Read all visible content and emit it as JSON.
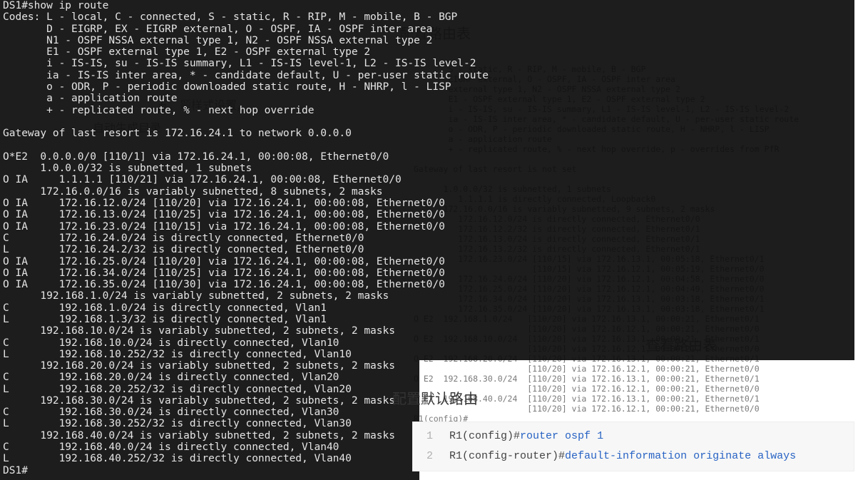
{
  "captions": {
    "topright": "配置路由表",
    "midleft1": "五、题样式设置,",
    "midleft2": "自动生成目录",
    "midright": "查看路由表",
    "center": "配置默认路由"
  },
  "front_terminal": "DS1#show ip route\nCodes: L - local, C - connected, S - static, R - RIP, M - mobile, B - BGP\n       D - EIGRP, EX - EIGRP external, O - OSPF, IA - OSPF inter area\n       N1 - OSPF NSSA external type 1, N2 - OSPF NSSA external type 2\n       E1 - OSPF external type 1, E2 - OSPF external type 2\n       i - IS-IS, su - IS-IS summary, L1 - IS-IS level-1, L2 - IS-IS level-2\n       ia - IS-IS inter area, * - candidate default, U - per-user static route\n       o - ODR, P - periodic downloaded static route, H - NHRP, l - LISP\n       a - application route\n       + - replicated route, % - next hop override\n\nGateway of last resort is 172.16.24.1 to network 0.0.0.0\n\nO*E2  0.0.0.0/0 [110/1] via 172.16.24.1, 00:00:08, Ethernet0/0\n      1.0.0.0/32 is subnetted, 1 subnets\nO IA     1.1.1.1 [110/21] via 172.16.24.1, 00:00:08, Ethernet0/0\n      172.16.0.0/16 is variably subnetted, 8 subnets, 2 masks\nO IA     172.16.12.0/24 [110/20] via 172.16.24.1, 00:00:08, Ethernet0/0\nO IA     172.16.13.0/24 [110/25] via 172.16.24.1, 00:00:08, Ethernet0/0\nO IA     172.16.23.0/24 [110/15] via 172.16.24.1, 00:00:08, Ethernet0/0\nC        172.16.24.0/24 is directly connected, Ethernet0/0\nL        172.16.24.2/32 is directly connected, Ethernet0/0\nO IA     172.16.25.0/24 [110/20] via 172.16.24.1, 00:00:08, Ethernet0/0\nO IA     172.16.34.0/24 [110/25] via 172.16.24.1, 00:00:08, Ethernet0/0\nO IA     172.16.35.0/24 [110/30] via 172.16.24.1, 00:00:08, Ethernet0/0\n      192.168.1.0/24 is variably subnetted, 2 subnets, 2 masks\nC        192.168.1.0/24 is directly connected, Vlan1\nL        192.168.1.3/32 is directly connected, Vlan1\n      192.168.10.0/24 is variably subnetted, 2 subnets, 2 masks\nC        192.168.10.0/24 is directly connected, Vlan10\nL        192.168.10.252/32 is directly connected, Vlan10",
  "front_terminal_cont": "      192.168.20.0/24 is variably subnetted, 2 subnets, 2 masks\nC        192.168.20.0/24 is directly connected, Vlan20\nL        192.168.20.252/32 is directly connected, Vlan20\n      192.168.30.0/24 is variably subnetted, 2 subnets, 2 masks\nC        192.168.30.0/24 is directly connected, Vlan30\nL        192.168.30.252/32 is directly connected, Vlan30\n      192.168.40.0/24 is variably subnetted, 2 subnets, 2 masks\nC        192.168.40.0/24 is directly connected, Vlan40\nL        192.168.40.252/32 is directly connected, Vlan40\nDS1#",
  "back_terminal": "       S - static, R - RIP, M - mobile, B - BGP\n       EIGRP external, O - OSPF, IA - OSPF inter area\n       external type 1, N2 - OSPF NSSA external type 2\n       E1 - OSPF external type 1, E2 - OSPF external type 2\n       i - IS-IS, su - IS-IS summary, L1 - IS-IS level-1, L2 - IS-IS level-2\n       ia - IS-IS inter area, * - candidate default, U - per-user static route\n       o - ODR, P - periodic downloaded static route, H - NHRP, l - LISP\n       a - application route\n       + - replicated route, % - next hop override, p - overrides from PfR\n\nGateway of last resort is not set\n\n      1.0.0.0/32 is subnetted, 1 subnets\n         1.1.1.1 is directly connected, Loopback0\n      172.16.0.0/16 is variably subnetted, 9 subnets, 2 masks\n         172.16.12.0/24 is directly connected, Ethernet0/0\n         172.16.12.2/32 is directly connected, Ethernet0/1\n         172.16.13.0/24 is directly connected, Ethernet0/1\n         172.16.13.2/32 is directly connected, Ethernet0/1\n         172.16.23.0/24 [110/15] via 172.16.13.1, 00:05:18, Ethernet0/1\n                        [110/15] via 172.16.12.1, 00:05:19, Ethernet0/0\n         172.16.24.0/24 [110/20] via 172.16.12.1, 00:04:58, Ethernet0/0\n         172.16.25.0/24 [110/20] via 172.16.12.1, 00:04:49, Ethernet0/0\n         172.16.34.0/24 [110/20] via 172.16.13.1, 00:03:18, Ethernet0/1\n         172.16.35.0/24 [110/20] via 172.16.13.1, 00:03:18, Ethernet0/1\nO E2  192.168.1.0/24   [110/20] via 172.16.13.1, 00:00:21, Ethernet0/1\n                       [110/20] via 172.16.12.1, 00:00:21, Ethernet0/0\nO E2  192.168.10.0/24  [110/20] via 172.16.13.1, 00:00:21, Ethernet0/1\n                       [110/20] via 172.16.12.1, 00:00:21, Ethernet0/0\nO E2  192.168.20.0/24  [110/20] via 172.16.13.1, 00:00:21, Ethernet0/1\n                       [110/20] via 172.16.12.1, 00:00:21, Ethernet0/0\nO E2  192.168.30.0/24  [110/20] via 172.16.13.1, 00:00:21, Ethernet0/1\n                       [110/20] via 172.16.12.1, 00:00:21, Ethernet0/0\nO E2  192.168.40.0/24  [110/20] via 172.16.13.1, 00:00:21, Ethernet0/1\n                       [110/20] via 172.16.12.1, 00:00:21, Ethernet0/0\nR1(config)#\nR1(config)#",
  "right_panel": {
    "title": "配置默认路由",
    "lines": [
      {
        "n": "1",
        "pre": "R1(config)#",
        "cmd": "router ospf 1"
      },
      {
        "n": "2",
        "pre": "R1(config-router)#",
        "cmd": "default-information originate always"
      }
    ]
  }
}
